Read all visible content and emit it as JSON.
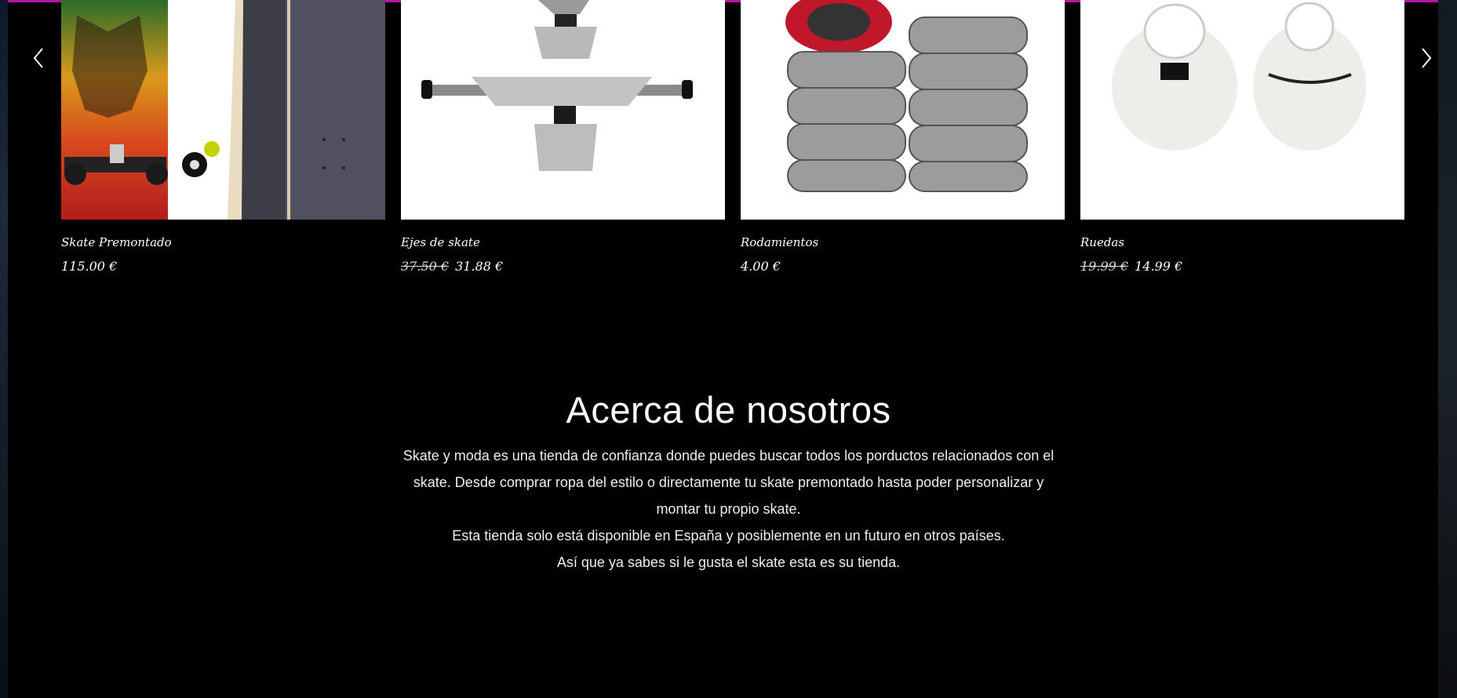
{
  "colors": {
    "accent": "#b5179e",
    "background": "#000000",
    "text": "#ffffff"
  },
  "gallery": {
    "prev_icon": "chevron-left-icon",
    "next_icon": "chevron-right-icon",
    "products": [
      {
        "name": "Skate Premontado",
        "price": "115.00 €"
      },
      {
        "name": "Ejes de skate",
        "old_price": "37.50 €",
        "price": "31.88 €"
      },
      {
        "name": "Rodamientos",
        "price": "4.00 €"
      },
      {
        "name": "Ruedas",
        "old_price": "19.99 €",
        "price": "14.99 €"
      }
    ]
  },
  "about": {
    "title": "Acerca de nosotros",
    "paragraph_1": "Skate y moda es una tienda de confianza donde puedes buscar todos los porductos relacionados con el skate. Desde comprar ropa del estilo o directamente tu skate premontado hasta poder personalizar y montar tu propio skate.",
    "paragraph_2": "Esta tienda solo está disponible en España y posiblemente en un futuro en otros países.",
    "paragraph_3": "Así que ya sabes si le gusta el skate esta es su tienda."
  }
}
